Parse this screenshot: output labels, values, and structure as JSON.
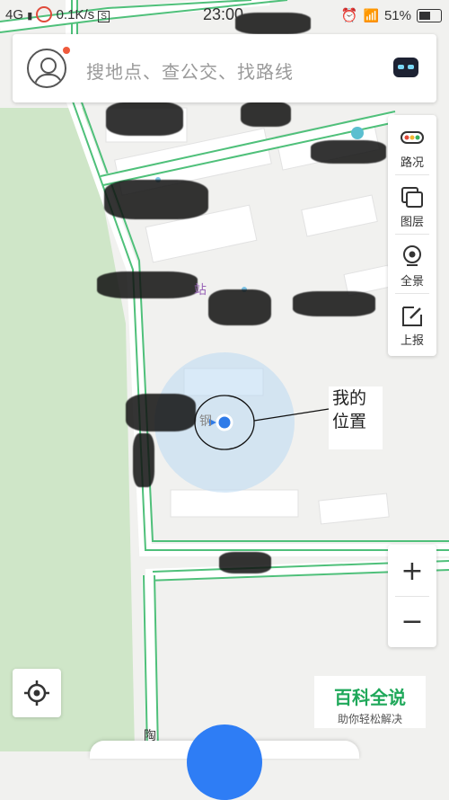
{
  "status_bar": {
    "network": "4G",
    "speed": "0.1K/s",
    "time": "23:00",
    "battery": "51%"
  },
  "search": {
    "placeholder": "搜地点、查公交、找路线"
  },
  "toolbar": {
    "items": [
      {
        "label": "路况",
        "icon": "traffic-icon"
      },
      {
        "label": "图层",
        "icon": "layers-icon"
      },
      {
        "label": "全景",
        "icon": "panorama-icon"
      },
      {
        "label": "上报",
        "icon": "report-icon"
      }
    ]
  },
  "zoom": {
    "in": "+",
    "out": "−"
  },
  "map": {
    "labels": {
      "station_fragment": "站",
      "poi_fragment": "钢",
      "road_fragment": "陶"
    },
    "location_annotation": "我的位置"
  },
  "watermark": {
    "title": "百科全说",
    "subtitle": "助你轻松解决"
  },
  "colors": {
    "road_stroke": "#4fc07a",
    "location_blue": "#2f7be8",
    "accent": "#1fa85a"
  }
}
